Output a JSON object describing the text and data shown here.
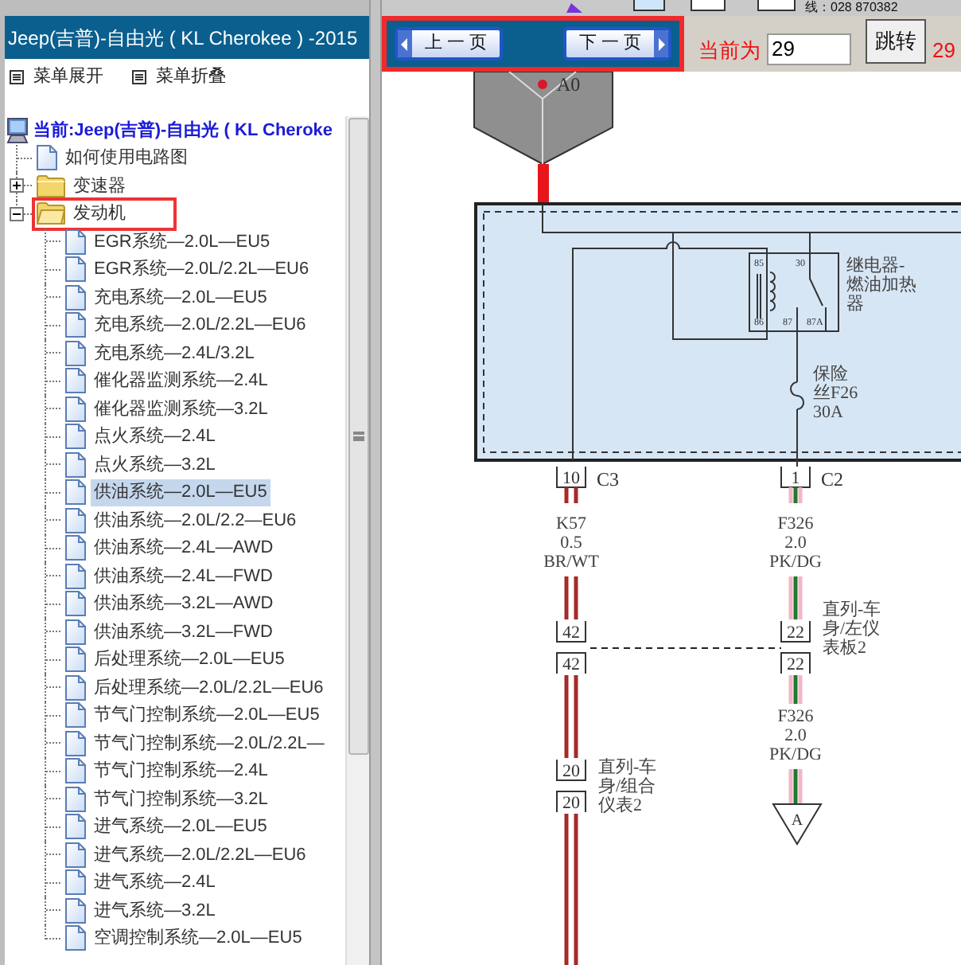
{
  "window_title": "Jeep(吉普)-自由光 ( KL Cherokee ) -2015",
  "menu": [
    {
      "label": "菜单展开"
    },
    {
      "label": "菜单折叠"
    }
  ],
  "tree": {
    "label": "当前:Jeep(吉普)-自由光 ( KL Cheroke",
    "children": [
      {
        "label": "如何使用电路图",
        "kind": "doc",
        "selected": false
      },
      {
        "label": "变速器",
        "kind": "folder",
        "expanded": false,
        "highlighted": false
      },
      {
        "label": "发动机",
        "kind": "folder",
        "expanded": true,
        "highlighted": true,
        "children": [
          {
            "label": "EGR系统—2.0L—EU5",
            "kind": "doc",
            "selected": false
          },
          {
            "label": "EGR系统—2.0L/2.2L—EU6",
            "kind": "doc",
            "selected": false
          },
          {
            "label": "充电系统—2.0L—EU5",
            "kind": "doc",
            "selected": false
          },
          {
            "label": "充电系统—2.0L/2.2L—EU6",
            "kind": "doc",
            "selected": false
          },
          {
            "label": "充电系统—2.4L/3.2L",
            "kind": "doc",
            "selected": false
          },
          {
            "label": "催化器监测系统—2.4L",
            "kind": "doc",
            "selected": false
          },
          {
            "label": "催化器监测系统—3.2L",
            "kind": "doc",
            "selected": false
          },
          {
            "label": "点火系统—2.4L",
            "kind": "doc",
            "selected": false
          },
          {
            "label": "点火系统—3.2L",
            "kind": "doc",
            "selected": false
          },
          {
            "label": "供油系统—2.0L—EU5",
            "kind": "doc",
            "selected": true
          },
          {
            "label": "供油系统—2.0L/2.2—EU6",
            "kind": "doc",
            "selected": false
          },
          {
            "label": "供油系统—2.4L—AWD",
            "kind": "doc",
            "selected": false
          },
          {
            "label": "供油系统—2.4L—FWD",
            "kind": "doc",
            "selected": false
          },
          {
            "label": "供油系统—3.2L—AWD",
            "kind": "doc",
            "selected": false
          },
          {
            "label": "供油系统—3.2L—FWD",
            "kind": "doc",
            "selected": false
          },
          {
            "label": "后处理系统—2.0L—EU5",
            "kind": "doc",
            "selected": false
          },
          {
            "label": "后处理系统—2.0L/2.2L—EU6",
            "kind": "doc",
            "selected": false
          },
          {
            "label": "节气门控制系统—2.0L—EU5",
            "kind": "doc",
            "selected": false
          },
          {
            "label": "节气门控制系统—2.0L/2.2L—",
            "kind": "doc",
            "selected": false
          },
          {
            "label": "节气门控制系统—2.4L",
            "kind": "doc",
            "selected": false
          },
          {
            "label": "节气门控制系统—3.2L",
            "kind": "doc",
            "selected": false
          },
          {
            "label": "进气系统—2.0L—EU5",
            "kind": "doc",
            "selected": false
          },
          {
            "label": "进气系统—2.0L/2.2L—EU6",
            "kind": "doc",
            "selected": false
          },
          {
            "label": "进气系统—2.4L",
            "kind": "doc",
            "selected": false
          },
          {
            "label": "进气系统—3.2L",
            "kind": "doc",
            "selected": false
          },
          {
            "label": "空调控制系统—2.0L—EU5",
            "kind": "doc",
            "selected": false
          }
        ]
      }
    ]
  },
  "top_strip_text": "线：028 870382",
  "toolbar": {
    "highlighted": true,
    "buttons": [
      {
        "label": "上 一 页",
        "kind": "prev"
      },
      {
        "label": "下 一 页",
        "kind": "next"
      }
    ],
    "current_label": "当前为",
    "page_input": "29",
    "jump_button": "跳转",
    "total": "29"
  },
  "diagram": {
    "component_label": "A0",
    "relay_label": [
      "继电器-",
      "燃油加热",
      "器"
    ],
    "relay_pins": [
      "85",
      "30",
      "86",
      "87",
      "87A"
    ],
    "fuse_label": [
      "保险",
      "丝F26",
      "30A"
    ],
    "circuits": [
      {
        "pin": "10",
        "connector": "C3",
        "wire_lines": [
          "K57",
          "0.5",
          "BR/WT"
        ],
        "wire_strands": [
          {
            "color": "#a52a2a"
          },
          {
            "color": "#a52a2a"
          }
        ],
        "inline": {
          "pins": [
            "42",
            "42"
          ]
        },
        "inline2": {
          "pins": [
            "20",
            "20"
          ],
          "label": [
            "直列-车",
            "身/组合",
            "仪表2"
          ]
        }
      },
      {
        "pin": "1",
        "connector": "C2",
        "wire_lines": [
          "F326",
          "2.0",
          "PK/DG"
        ],
        "wire_strands": [
          {
            "color": "#f2b6c6"
          },
          {
            "color": "#1e7a2e"
          },
          {
            "color": "#f2b6c6"
          }
        ],
        "inline": {
          "pins": [
            "22",
            "22"
          ],
          "label": [
            "直列-车",
            "身/左仪",
            "表板2"
          ]
        },
        "wire_lines_2": [
          "F326",
          "2.0",
          "PK/DG"
        ],
        "terminal": "A"
      }
    ]
  }
}
